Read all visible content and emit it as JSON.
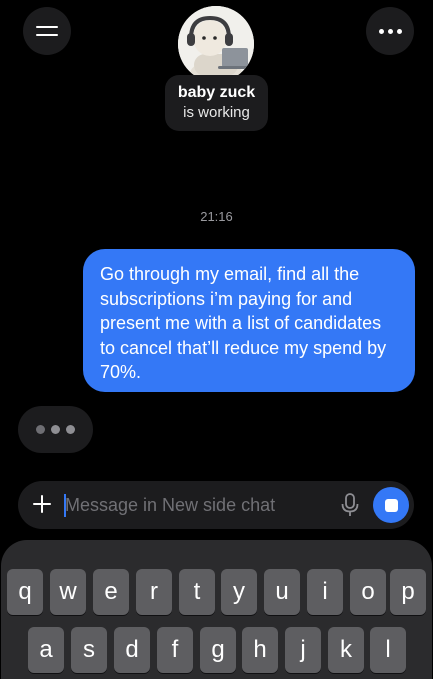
{
  "agent": {
    "name": "baby zuck",
    "status": "is working"
  },
  "chat": {
    "timestamp": "21:16",
    "outgoing_message": "Go through my email, find all the subscriptions i’m paying for and present me with a list of candidates to cancel that’ll reduce my spend by 70%."
  },
  "composer": {
    "placeholder": "Message in New side chat",
    "value": ""
  },
  "keyboard": {
    "row1": [
      "q",
      "w",
      "e",
      "r",
      "t",
      "y",
      "u",
      "i",
      "o",
      "p"
    ],
    "row2": [
      "a",
      "s",
      "d",
      "f",
      "g",
      "h",
      "j",
      "k",
      "l"
    ]
  },
  "colors": {
    "accent": "#3478f6",
    "background": "#000000",
    "surface": "#1c1c1e",
    "key": "#5e5e61"
  },
  "icons": {
    "menu": "hamburger-icon",
    "more": "more-dots-icon",
    "attach": "plus-icon",
    "mic": "microphone-icon",
    "send": "stop-square-icon"
  }
}
